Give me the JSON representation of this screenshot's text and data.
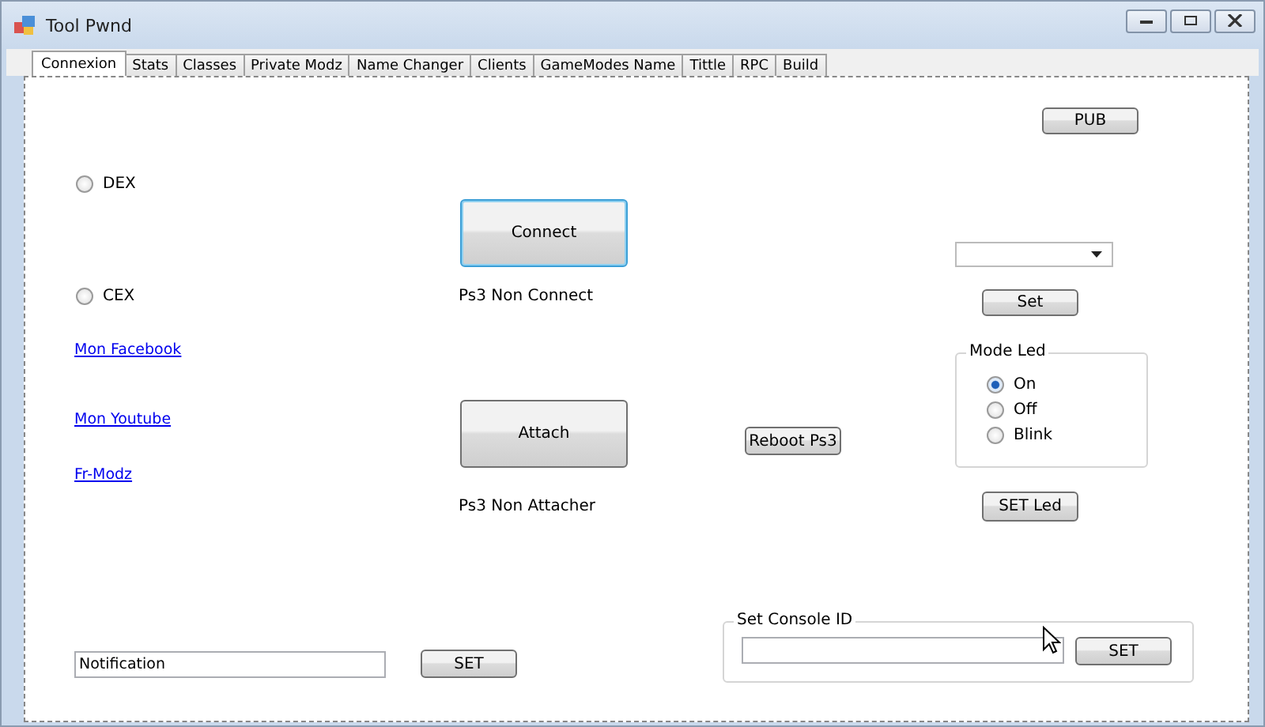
{
  "window": {
    "title": "Tool Pwnd"
  },
  "tabs": [
    {
      "label": "Connexion",
      "selected": true
    },
    {
      "label": "Stats",
      "selected": false
    },
    {
      "label": "Classes",
      "selected": false
    },
    {
      "label": "Private Modz",
      "selected": false
    },
    {
      "label": "Name Changer",
      "selected": false
    },
    {
      "label": "Clients",
      "selected": false
    },
    {
      "label": "GameModes Name",
      "selected": false
    },
    {
      "label": "Tittle",
      "selected": false
    },
    {
      "label": "RPC",
      "selected": false
    },
    {
      "label": "Build",
      "selected": false
    }
  ],
  "pub_button": "PUB",
  "console_type": [
    {
      "label": "DEX",
      "selected": false
    },
    {
      "label": "CEX",
      "selected": false
    }
  ],
  "links": [
    "Mon Facebook",
    "Mon Youtube",
    "Fr-Modz"
  ],
  "connect": {
    "button": "Connect",
    "focused": true,
    "status": "Ps3 Non Connect"
  },
  "attach": {
    "button": "Attach",
    "focused": false,
    "status": "Ps3 Non Attacher"
  },
  "reboot_button": "Reboot Ps3",
  "set_button": "Set",
  "mode_led": {
    "title": "Mode Led",
    "options": [
      {
        "label": "On",
        "selected": true
      },
      {
        "label": "Off",
        "selected": false
      },
      {
        "label": "Blink",
        "selected": false
      }
    ],
    "button": "SET Led"
  },
  "notification": {
    "value": "Notification",
    "button": "SET"
  },
  "console_id": {
    "title": "Set Console ID",
    "button": "SET"
  }
}
